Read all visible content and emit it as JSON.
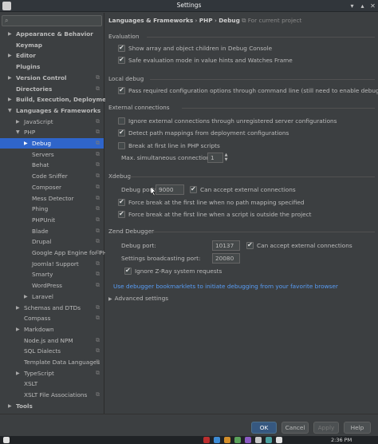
{
  "window": {
    "title": "Settings"
  },
  "search": {
    "placeholder": ""
  },
  "tree": [
    {
      "label": "Appearance & Behavior",
      "bold": true,
      "arrow": "▶",
      "indent": 0,
      "project": false,
      "selected": false
    },
    {
      "label": "Keymap",
      "bold": true,
      "arrow": "",
      "indent": 0,
      "project": false,
      "selected": false
    },
    {
      "label": "Editor",
      "bold": true,
      "arrow": "▶",
      "indent": 0,
      "project": false,
      "selected": false
    },
    {
      "label": "Plugins",
      "bold": true,
      "arrow": "",
      "indent": 0,
      "project": false,
      "selected": false
    },
    {
      "label": "Version Control",
      "bold": true,
      "arrow": "▶",
      "indent": 0,
      "project": true,
      "selected": false
    },
    {
      "label": "Directories",
      "bold": true,
      "arrow": "",
      "indent": 0,
      "project": true,
      "selected": false
    },
    {
      "label": "Build, Execution, Deployment",
      "bold": true,
      "arrow": "▶",
      "indent": 0,
      "project": false,
      "selected": false
    },
    {
      "label": "Languages & Frameworks",
      "bold": true,
      "arrow": "▼",
      "indent": 0,
      "project": false,
      "selected": false
    },
    {
      "label": "JavaScript",
      "bold": false,
      "arrow": "▶",
      "indent": 1,
      "project": true,
      "selected": false
    },
    {
      "label": "PHP",
      "bold": false,
      "arrow": "▼",
      "indent": 1,
      "project": true,
      "selected": false
    },
    {
      "label": "Debug",
      "bold": false,
      "arrow": "▶",
      "indent": 2,
      "project": true,
      "selected": true
    },
    {
      "label": "Servers",
      "bold": false,
      "arrow": "",
      "indent": 2,
      "project": true,
      "selected": false
    },
    {
      "label": "Behat",
      "bold": false,
      "arrow": "",
      "indent": 2,
      "project": true,
      "selected": false
    },
    {
      "label": "Code Sniffer",
      "bold": false,
      "arrow": "",
      "indent": 2,
      "project": true,
      "selected": false
    },
    {
      "label": "Composer",
      "bold": false,
      "arrow": "",
      "indent": 2,
      "project": true,
      "selected": false
    },
    {
      "label": "Mess Detector",
      "bold": false,
      "arrow": "",
      "indent": 2,
      "project": true,
      "selected": false
    },
    {
      "label": "Phing",
      "bold": false,
      "arrow": "",
      "indent": 2,
      "project": true,
      "selected": false
    },
    {
      "label": "PHPUnit",
      "bold": false,
      "arrow": "",
      "indent": 2,
      "project": true,
      "selected": false
    },
    {
      "label": "Blade",
      "bold": false,
      "arrow": "",
      "indent": 2,
      "project": true,
      "selected": false
    },
    {
      "label": "Drupal",
      "bold": false,
      "arrow": "",
      "indent": 2,
      "project": true,
      "selected": false
    },
    {
      "label": "Google App Engine for PHP",
      "bold": false,
      "arrow": "",
      "indent": 2,
      "project": true,
      "selected": false
    },
    {
      "label": "Joomla! Support",
      "bold": false,
      "arrow": "",
      "indent": 2,
      "project": true,
      "selected": false
    },
    {
      "label": "Smarty",
      "bold": false,
      "arrow": "",
      "indent": 2,
      "project": true,
      "selected": false
    },
    {
      "label": "WordPress",
      "bold": false,
      "arrow": "",
      "indent": 2,
      "project": true,
      "selected": false
    },
    {
      "label": "Laravel",
      "bold": false,
      "arrow": "▶",
      "indent": 2,
      "project": false,
      "selected": false
    },
    {
      "label": "Schemas and DTDs",
      "bold": false,
      "arrow": "▶",
      "indent": 1,
      "project": true,
      "selected": false
    },
    {
      "label": "Compass",
      "bold": false,
      "arrow": "",
      "indent": 1,
      "project": true,
      "selected": false
    },
    {
      "label": "Markdown",
      "bold": false,
      "arrow": "▶",
      "indent": 1,
      "project": false,
      "selected": false
    },
    {
      "label": "Node.js and NPM",
      "bold": false,
      "arrow": "",
      "indent": 1,
      "project": true,
      "selected": false
    },
    {
      "label": "SQL Dialects",
      "bold": false,
      "arrow": "",
      "indent": 1,
      "project": true,
      "selected": false
    },
    {
      "label": "Template Data Languages",
      "bold": false,
      "arrow": "",
      "indent": 1,
      "project": true,
      "selected": false
    },
    {
      "label": "TypeScript",
      "bold": false,
      "arrow": "▶",
      "indent": 1,
      "project": true,
      "selected": false
    },
    {
      "label": "XSLT",
      "bold": false,
      "arrow": "",
      "indent": 1,
      "project": false,
      "selected": false
    },
    {
      "label": "XSLT File Associations",
      "bold": false,
      "arrow": "",
      "indent": 1,
      "project": true,
      "selected": false
    },
    {
      "label": "Tools",
      "bold": true,
      "arrow": "▶",
      "indent": 0,
      "project": false,
      "selected": false
    }
  ],
  "breadcrumb": {
    "part1": "Languages & Frameworks",
    "sep1": "›",
    "part2": "PHP",
    "sep2": "›",
    "part3": "Debug",
    "hint_icon": "⧉",
    "hint": "For current project"
  },
  "evaluation": {
    "header": "Evaluation",
    "show_array": {
      "label": "Show array and object children in Debug Console",
      "checked": true
    },
    "safe_mode": {
      "label": "Safe evaluation mode in value hints and Watches Frame",
      "checked": true
    }
  },
  "local_debug": {
    "header": "Local debug",
    "pass_config": {
      "label": "Pass required configuration options through command line (still need to enable debug extension manua",
      "checked": true
    }
  },
  "external": {
    "header": "External connections",
    "ignore_unregistered": {
      "label": "Ignore external connections through unregistered server configurations",
      "checked": false
    },
    "detect_mappings": {
      "label": "Detect path mappings from deployment configurations",
      "checked": true
    },
    "break_first_line": {
      "label": "Break at first line in PHP scripts",
      "checked": false
    },
    "max_connections_label": "Max. simultaneous connections:",
    "max_connections_value": "1"
  },
  "xdebug": {
    "header": "Xdebug",
    "debug_port_label": "Debug port:",
    "debug_port_value": "9000",
    "accept_external": {
      "label": "Can accept external connections",
      "checked": true
    },
    "force_break_no_mapping": {
      "label": "Force break at the first line when no path mapping specified",
      "checked": true
    },
    "force_break_outside": {
      "label": "Force break at the first line when a script is outside the project",
      "checked": true
    }
  },
  "zend": {
    "header": "Zend Debugger",
    "debug_port_label": "Debug port:",
    "debug_port_value": "10137",
    "accept_external": {
      "label": "Can accept external connections",
      "checked": true
    },
    "broadcast_label": "Settings broadcasting port:",
    "broadcast_value": "20080",
    "ignore_zray": {
      "label": "Ignore Z-Ray system requests",
      "checked": true
    }
  },
  "bookmarklets_link": "Use debugger bookmarklets to initiate debugging from your favorite browser",
  "advanced": "Advanced settings",
  "buttons": {
    "ok": "OK",
    "cancel": "Cancel",
    "apply": "Apply",
    "help": "Help"
  },
  "taskbar": {
    "clock": "2:36 PM"
  }
}
